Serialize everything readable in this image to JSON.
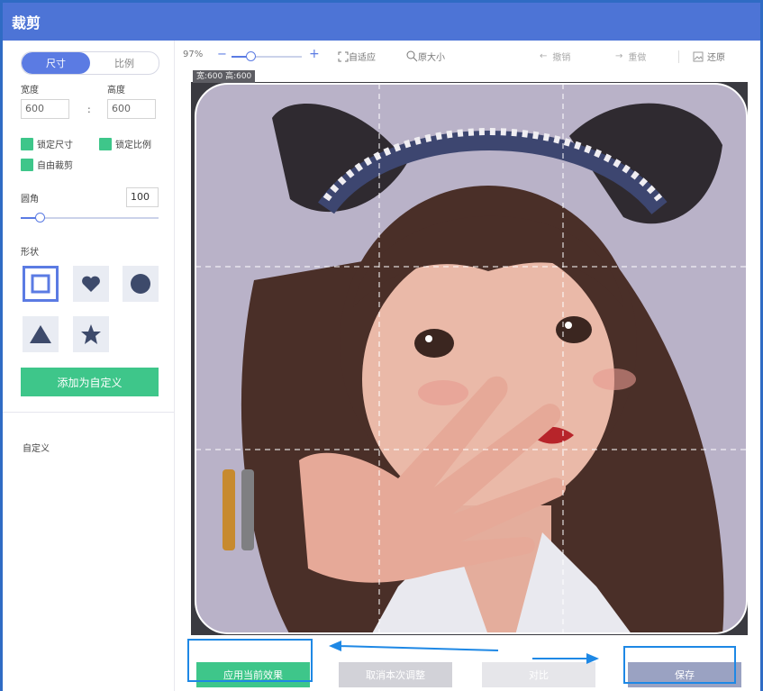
{
  "title": "裁剪",
  "tabs": {
    "size": "尺寸",
    "ratio": "比例"
  },
  "size": {
    "width_label": "宽度",
    "height_label": "高度",
    "width_value": "600",
    "height_value": "600",
    "colon": ":"
  },
  "options": {
    "lock_size": "锁定尺寸",
    "lock_ratio": "锁定比例",
    "free_crop": "自由裁剪"
  },
  "corner": {
    "label": "圆角",
    "value": "100",
    "fraction": 0.12
  },
  "shape": {
    "label": "形状",
    "shapes": [
      "square",
      "heart",
      "circle",
      "triangle",
      "star"
    ]
  },
  "add_custom_label": "添加为自定义",
  "custom_label": "自定义",
  "toolbar": {
    "zoom": "97%",
    "zoom_fraction": 0.28,
    "minus": "−",
    "plus": "+",
    "fit": "自适应",
    "original": "原大小",
    "undo": "撤销",
    "redo": "重做",
    "reset": "还原"
  },
  "size_tag": "宽:600 高:600",
  "bottom": {
    "apply": "应用当前效果",
    "cancel": "取消本次调整",
    "compare": "对比",
    "save": "保存"
  },
  "colors": {
    "accent": "#5b7be3",
    "green": "#3ec68a",
    "title_bar": "#4d74d6",
    "annotation": "#1e88e5"
  }
}
